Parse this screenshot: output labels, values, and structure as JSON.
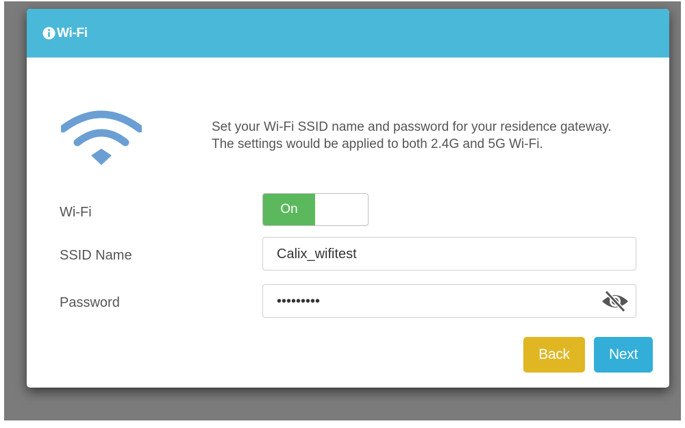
{
  "dialog": {
    "title": "Wi-Fi",
    "title_icon": "info-circle-icon",
    "hero_icon": "wifi-icon",
    "description": "Set your Wi-Fi SSID name and password for your residence gateway. The settings would be applied to both 2.4G and 5G Wi-Fi."
  },
  "wifi": {
    "label": "Wi-Fi",
    "toggle_state": "On"
  },
  "ssid": {
    "label": "SSID Name",
    "value": "Calix_wifitest"
  },
  "password": {
    "label": "Password",
    "value": "wifitest1",
    "visibility_icon": "eye-slash-icon"
  },
  "buttons": {
    "back": "Back",
    "next": "Next"
  },
  "colors": {
    "header": "#4ab8d9",
    "toggle_on": "#5cb85c",
    "back_button": "#e0b623",
    "next_button": "#33aed8",
    "wifi_icon": "#6b9fd3"
  }
}
